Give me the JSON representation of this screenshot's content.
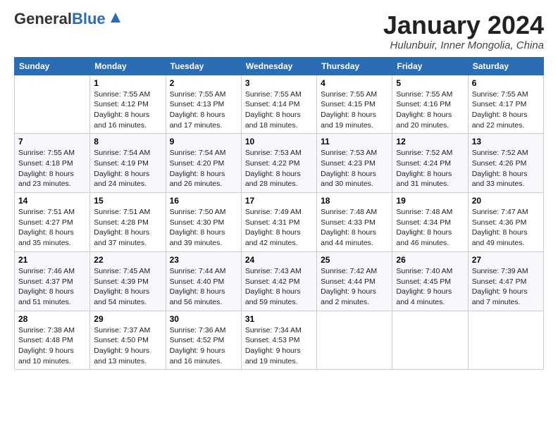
{
  "logo": {
    "general": "General",
    "blue": "Blue"
  },
  "title": "January 2024",
  "location": "Hulunbuir, Inner Mongolia, China",
  "days_of_week": [
    "Sunday",
    "Monday",
    "Tuesday",
    "Wednesday",
    "Thursday",
    "Friday",
    "Saturday"
  ],
  "weeks": [
    [
      {
        "day": "",
        "sunrise": "",
        "sunset": "",
        "daylight": ""
      },
      {
        "day": "1",
        "sunrise": "Sunrise: 7:55 AM",
        "sunset": "Sunset: 4:12 PM",
        "daylight": "Daylight: 8 hours and 16 minutes."
      },
      {
        "day": "2",
        "sunrise": "Sunrise: 7:55 AM",
        "sunset": "Sunset: 4:13 PM",
        "daylight": "Daylight: 8 hours and 17 minutes."
      },
      {
        "day": "3",
        "sunrise": "Sunrise: 7:55 AM",
        "sunset": "Sunset: 4:14 PM",
        "daylight": "Daylight: 8 hours and 18 minutes."
      },
      {
        "day": "4",
        "sunrise": "Sunrise: 7:55 AM",
        "sunset": "Sunset: 4:15 PM",
        "daylight": "Daylight: 8 hours and 19 minutes."
      },
      {
        "day": "5",
        "sunrise": "Sunrise: 7:55 AM",
        "sunset": "Sunset: 4:16 PM",
        "daylight": "Daylight: 8 hours and 20 minutes."
      },
      {
        "day": "6",
        "sunrise": "Sunrise: 7:55 AM",
        "sunset": "Sunset: 4:17 PM",
        "daylight": "Daylight: 8 hours and 22 minutes."
      }
    ],
    [
      {
        "day": "7",
        "sunrise": "Sunrise: 7:55 AM",
        "sunset": "Sunset: 4:18 PM",
        "daylight": "Daylight: 8 hours and 23 minutes."
      },
      {
        "day": "8",
        "sunrise": "Sunrise: 7:54 AM",
        "sunset": "Sunset: 4:19 PM",
        "daylight": "Daylight: 8 hours and 24 minutes."
      },
      {
        "day": "9",
        "sunrise": "Sunrise: 7:54 AM",
        "sunset": "Sunset: 4:20 PM",
        "daylight": "Daylight: 8 hours and 26 minutes."
      },
      {
        "day": "10",
        "sunrise": "Sunrise: 7:53 AM",
        "sunset": "Sunset: 4:22 PM",
        "daylight": "Daylight: 8 hours and 28 minutes."
      },
      {
        "day": "11",
        "sunrise": "Sunrise: 7:53 AM",
        "sunset": "Sunset: 4:23 PM",
        "daylight": "Daylight: 8 hours and 30 minutes."
      },
      {
        "day": "12",
        "sunrise": "Sunrise: 7:52 AM",
        "sunset": "Sunset: 4:24 PM",
        "daylight": "Daylight: 8 hours and 31 minutes."
      },
      {
        "day": "13",
        "sunrise": "Sunrise: 7:52 AM",
        "sunset": "Sunset: 4:26 PM",
        "daylight": "Daylight: 8 hours and 33 minutes."
      }
    ],
    [
      {
        "day": "14",
        "sunrise": "Sunrise: 7:51 AM",
        "sunset": "Sunset: 4:27 PM",
        "daylight": "Daylight: 8 hours and 35 minutes."
      },
      {
        "day": "15",
        "sunrise": "Sunrise: 7:51 AM",
        "sunset": "Sunset: 4:28 PM",
        "daylight": "Daylight: 8 hours and 37 minutes."
      },
      {
        "day": "16",
        "sunrise": "Sunrise: 7:50 AM",
        "sunset": "Sunset: 4:30 PM",
        "daylight": "Daylight: 8 hours and 39 minutes."
      },
      {
        "day": "17",
        "sunrise": "Sunrise: 7:49 AM",
        "sunset": "Sunset: 4:31 PM",
        "daylight": "Daylight: 8 hours and 42 minutes."
      },
      {
        "day": "18",
        "sunrise": "Sunrise: 7:48 AM",
        "sunset": "Sunset: 4:33 PM",
        "daylight": "Daylight: 8 hours and 44 minutes."
      },
      {
        "day": "19",
        "sunrise": "Sunrise: 7:48 AM",
        "sunset": "Sunset: 4:34 PM",
        "daylight": "Daylight: 8 hours and 46 minutes."
      },
      {
        "day": "20",
        "sunrise": "Sunrise: 7:47 AM",
        "sunset": "Sunset: 4:36 PM",
        "daylight": "Daylight: 8 hours and 49 minutes."
      }
    ],
    [
      {
        "day": "21",
        "sunrise": "Sunrise: 7:46 AM",
        "sunset": "Sunset: 4:37 PM",
        "daylight": "Daylight: 8 hours and 51 minutes."
      },
      {
        "day": "22",
        "sunrise": "Sunrise: 7:45 AM",
        "sunset": "Sunset: 4:39 PM",
        "daylight": "Daylight: 8 hours and 54 minutes."
      },
      {
        "day": "23",
        "sunrise": "Sunrise: 7:44 AM",
        "sunset": "Sunset: 4:40 PM",
        "daylight": "Daylight: 8 hours and 56 minutes."
      },
      {
        "day": "24",
        "sunrise": "Sunrise: 7:43 AM",
        "sunset": "Sunset: 4:42 PM",
        "daylight": "Daylight: 8 hours and 59 minutes."
      },
      {
        "day": "25",
        "sunrise": "Sunrise: 7:42 AM",
        "sunset": "Sunset: 4:44 PM",
        "daylight": "Daylight: 9 hours and 2 minutes."
      },
      {
        "day": "26",
        "sunrise": "Sunrise: 7:40 AM",
        "sunset": "Sunset: 4:45 PM",
        "daylight": "Daylight: 9 hours and 4 minutes."
      },
      {
        "day": "27",
        "sunrise": "Sunrise: 7:39 AM",
        "sunset": "Sunset: 4:47 PM",
        "daylight": "Daylight: 9 hours and 7 minutes."
      }
    ],
    [
      {
        "day": "28",
        "sunrise": "Sunrise: 7:38 AM",
        "sunset": "Sunset: 4:48 PM",
        "daylight": "Daylight: 9 hours and 10 minutes."
      },
      {
        "day": "29",
        "sunrise": "Sunrise: 7:37 AM",
        "sunset": "Sunset: 4:50 PM",
        "daylight": "Daylight: 9 hours and 13 minutes."
      },
      {
        "day": "30",
        "sunrise": "Sunrise: 7:36 AM",
        "sunset": "Sunset: 4:52 PM",
        "daylight": "Daylight: 9 hours and 16 minutes."
      },
      {
        "day": "31",
        "sunrise": "Sunrise: 7:34 AM",
        "sunset": "Sunset: 4:53 PM",
        "daylight": "Daylight: 9 hours and 19 minutes."
      },
      {
        "day": "",
        "sunrise": "",
        "sunset": "",
        "daylight": ""
      },
      {
        "day": "",
        "sunrise": "",
        "sunset": "",
        "daylight": ""
      },
      {
        "day": "",
        "sunrise": "",
        "sunset": "",
        "daylight": ""
      }
    ]
  ]
}
